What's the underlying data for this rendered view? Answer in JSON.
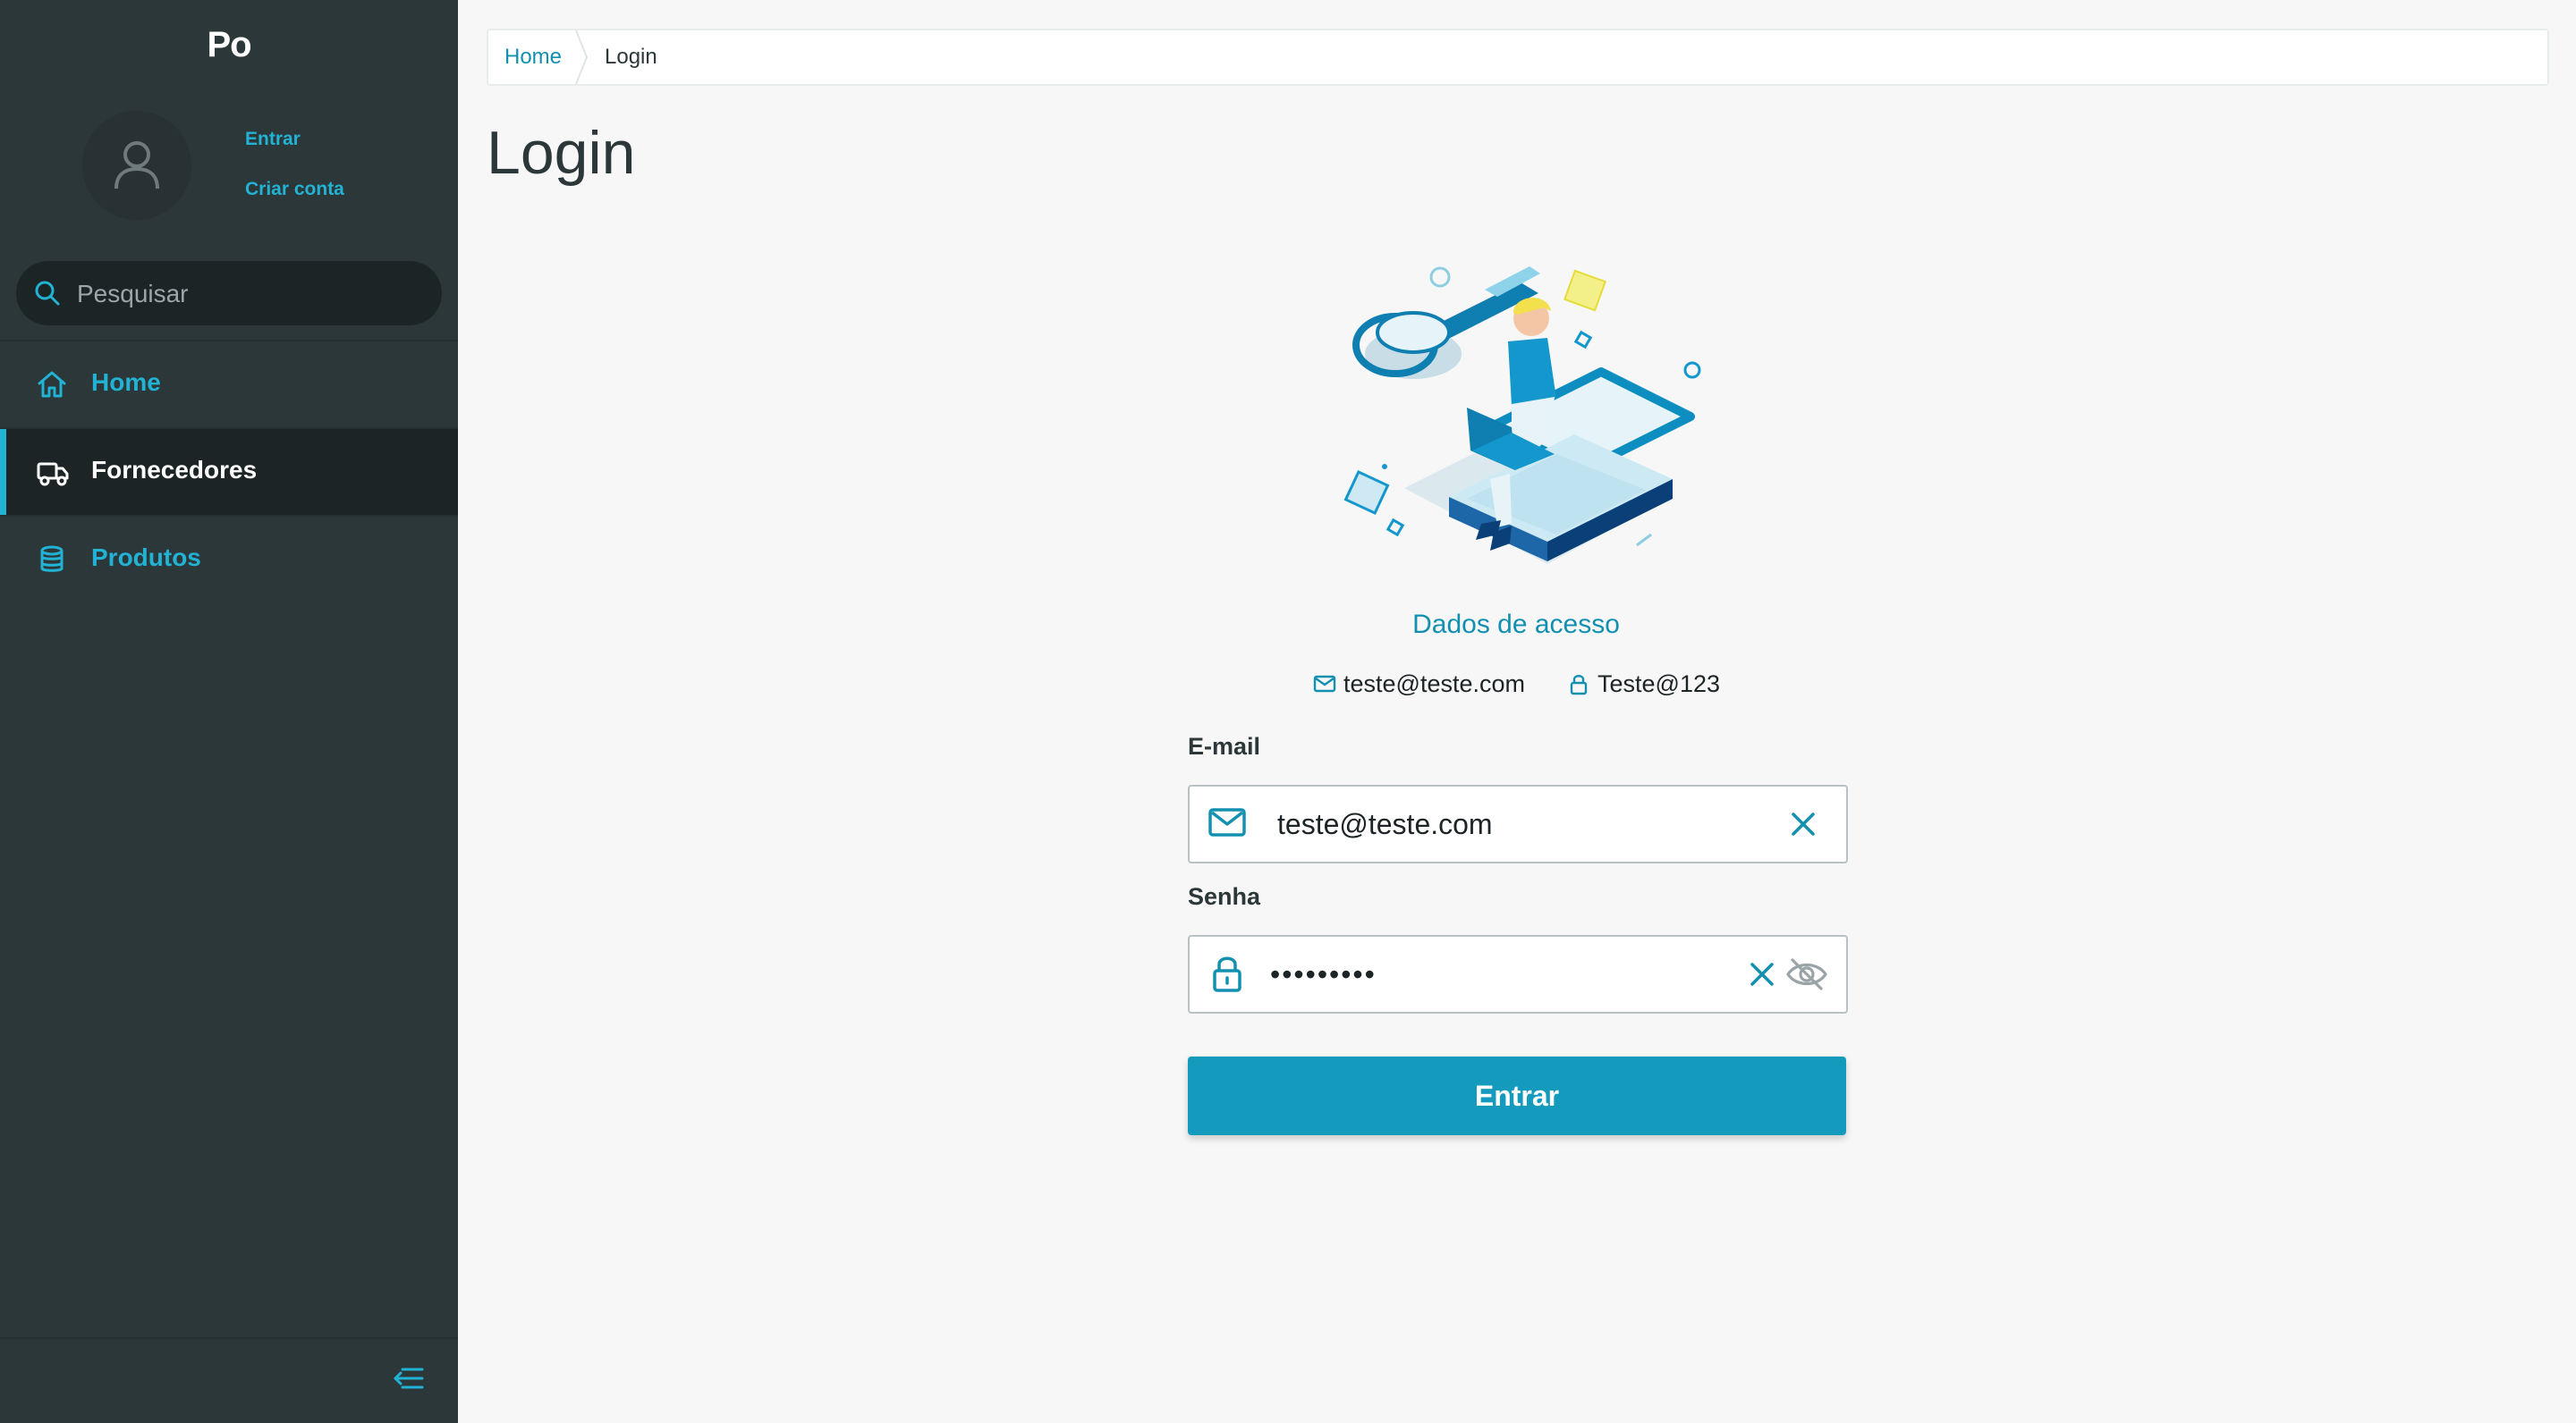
{
  "app": {
    "logo_text": "Po"
  },
  "sidebar": {
    "profile_links": {
      "login": "Entrar",
      "signup": "Criar conta"
    },
    "search": {
      "placeholder": "Pesquisar",
      "value": ""
    },
    "menu": [
      {
        "label": "Home",
        "icon": "home-icon"
      },
      {
        "label": "Fornecedores",
        "icon": "truck-icon",
        "active": true
      },
      {
        "label": "Produtos",
        "icon": "database-icon"
      }
    ],
    "collapse_icon": "collapse-menu-icon"
  },
  "breadcrumb": {
    "home": "Home",
    "current": "Login"
  },
  "page": {
    "title": "Login"
  },
  "access": {
    "title": "Dados de acesso",
    "email": "teste@teste.com",
    "password": "Teste@123"
  },
  "form": {
    "email_label": "E-mail",
    "email_value": "teste@teste.com",
    "password_label": "Senha",
    "password_value": "Teste@123",
    "submit_label": "Entrar"
  },
  "colors": {
    "sidebar_bg": "#2c3739",
    "accent": "#22b2d4",
    "primary_button": "#139abd",
    "page_bg": "#f7f7f7"
  }
}
